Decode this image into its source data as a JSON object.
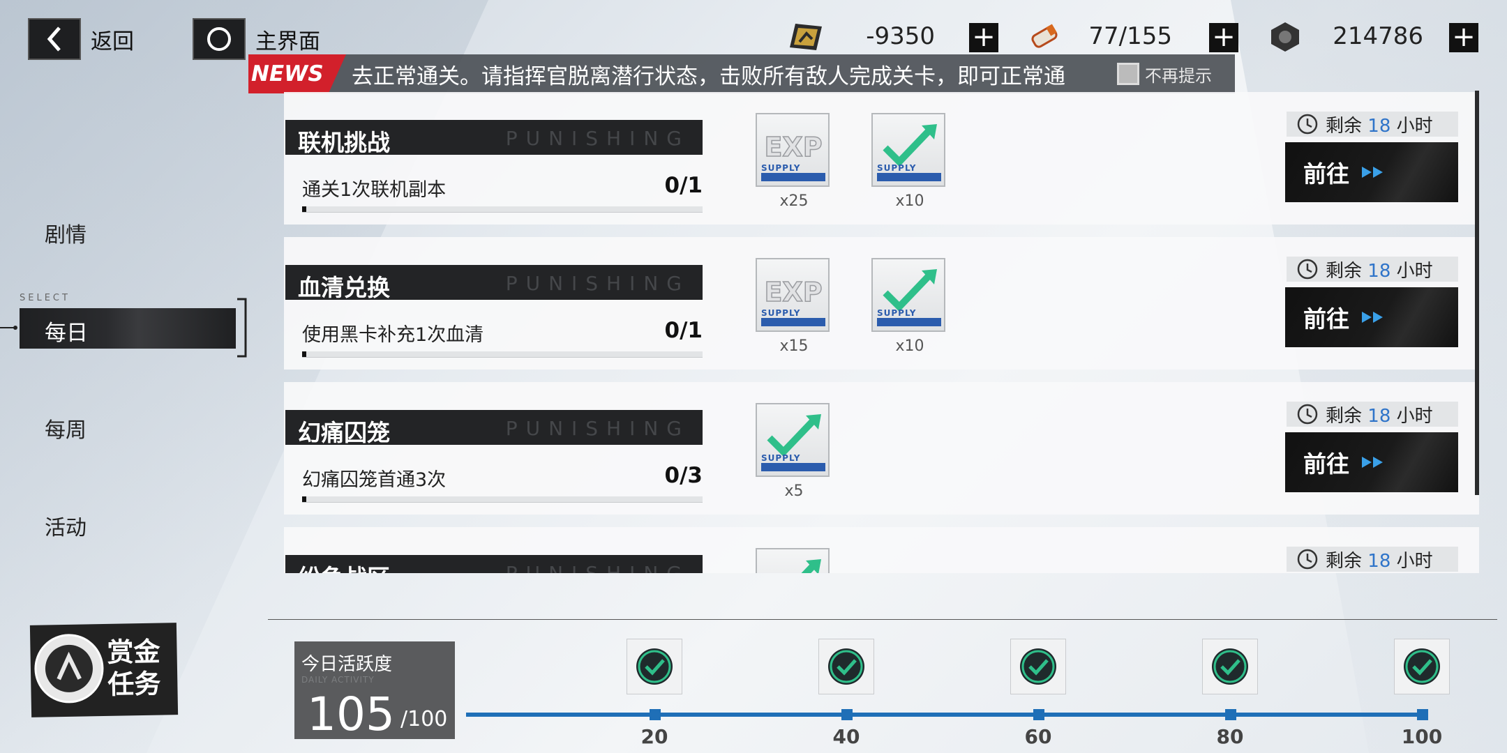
{
  "top": {
    "back_label": "返回",
    "home_label": "主界面"
  },
  "resources": [
    {
      "icon": "black-card-icon",
      "value": "-9350"
    },
    {
      "icon": "serum-icon",
      "value": "77/155"
    },
    {
      "icon": "coin-nut-icon",
      "value": "214786"
    }
  ],
  "news": {
    "tag": "NEWS",
    "text": "去正常通关。请指挥官脱离潜行状态，击败所有敌人完成关卡，即可正常通",
    "option_label": "不再提示"
  },
  "nav": {
    "select_tag": "SELECT",
    "items": [
      {
        "label": "剧情",
        "selected": false
      },
      {
        "label": "每日",
        "selected": true
      },
      {
        "label": "每周",
        "selected": false
      },
      {
        "label": "活动",
        "selected": false
      }
    ]
  },
  "tasks": [
    {
      "title": "联机挑战",
      "deco": "PUNISHING",
      "desc": "通关1次联机副本",
      "progress": "0/1",
      "progress_fraction": 0,
      "rewards": [
        {
          "icon": "exp-supply-icon",
          "qty": "x25",
          "word": "SUPPLY"
        },
        {
          "icon": "activity-check-supply-icon",
          "qty": "x10",
          "word": "SUPPLY"
        }
      ],
      "remain_prefix": "剩余",
      "remain_num": "18",
      "remain_suffix": "小时",
      "go_label": "前往"
    },
    {
      "title": "血清兑换",
      "deco": "PUNISHING",
      "desc": "使用黑卡补充1次血清",
      "progress": "0/1",
      "progress_fraction": 0,
      "rewards": [
        {
          "icon": "exp-supply-icon",
          "qty": "x15",
          "word": "SUPPLY"
        },
        {
          "icon": "activity-check-supply-icon",
          "qty": "x10",
          "word": "SUPPLY"
        }
      ],
      "remain_prefix": "剩余",
      "remain_num": "18",
      "remain_suffix": "小时",
      "go_label": "前往"
    },
    {
      "title": "幻痛囚笼",
      "deco": "PUNISHING",
      "desc": "幻痛囚笼首通3次",
      "progress": "0/3",
      "progress_fraction": 0,
      "rewards": [
        {
          "icon": "activity-check-supply-icon",
          "qty": "x5",
          "word": "SUPPLY"
        }
      ],
      "remain_prefix": "剩余",
      "remain_num": "18",
      "remain_suffix": "小时",
      "go_label": "前往"
    },
    {
      "title": "纷争战区",
      "deco": "PUNISHING",
      "remain_prefix": "剩余",
      "remain_num": "18",
      "remain_suffix": "小时"
    }
  ],
  "bounty": {
    "label_line1": "赏金",
    "label_line2": "任务"
  },
  "activity": {
    "title": "今日活跃度",
    "subtitle": "DAILY ACTIVITY",
    "value": "105",
    "max": "/100",
    "milestones": [
      "20",
      "40",
      "60",
      "80",
      "100"
    ]
  },
  "colors": {
    "accent_blue": "#1f6fb7",
    "news_red": "#d2202b",
    "check_green": "#2fbf8a"
  }
}
